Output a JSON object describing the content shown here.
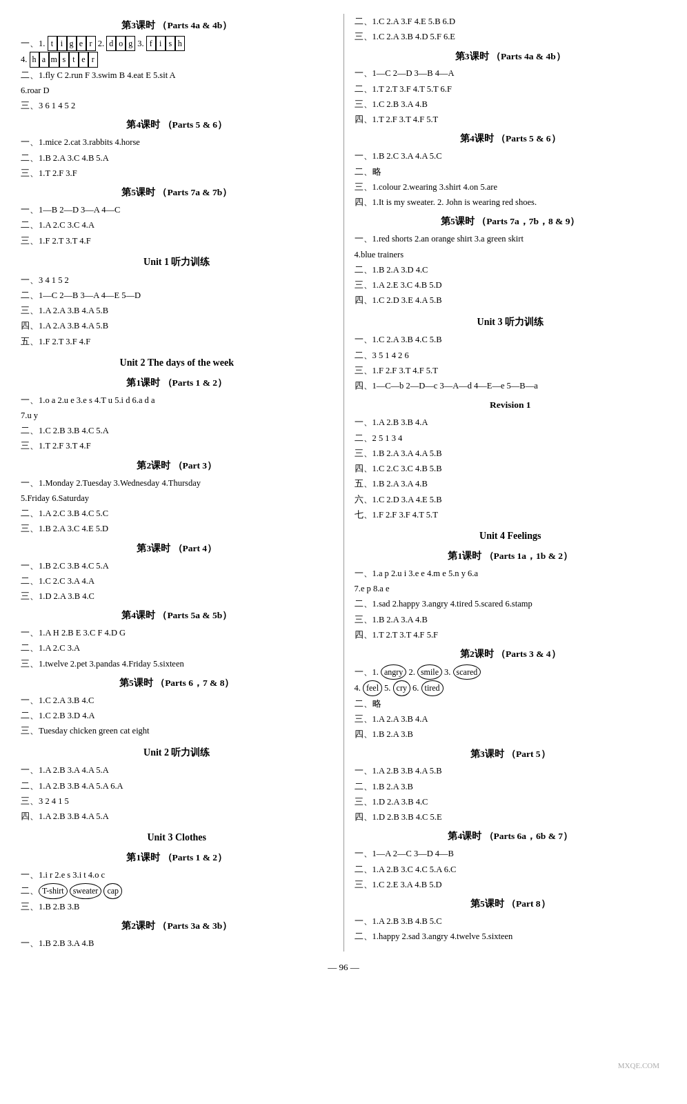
{
  "page": {
    "number": "96",
    "left_col": [
      {
        "type": "section",
        "text": "第3课时  （Parts 4a & 4b）"
      },
      {
        "type": "line",
        "text": "一、1. t i g e r  2. d o g  3. f i s h"
      },
      {
        "type": "line",
        "text": "4. h a m s t e r"
      },
      {
        "type": "line",
        "text": "二、1.fly  C  2.run  F  3.swim  B  4.eat  E  5.sit  A"
      },
      {
        "type": "line",
        "text": "6.roar  D"
      },
      {
        "type": "line",
        "text": "三、3  6  1  4  5  2"
      },
      {
        "type": "section",
        "text": "第4课时  （Parts 5 & 6）"
      },
      {
        "type": "line",
        "text": "一、1.mice  2.cat  3.rabbits  4.horse"
      },
      {
        "type": "line",
        "text": "二、1.B  2.A  3.C  4.B  5.A"
      },
      {
        "type": "line",
        "text": "三、1.T  2.F  3.F"
      },
      {
        "type": "section",
        "text": "第5课时  （Parts 7a & 7b）"
      },
      {
        "type": "line",
        "text": "一、1—B  2—D  3—A  4—C"
      },
      {
        "type": "line",
        "text": "二、1.A  2.C  3.C  4.A"
      },
      {
        "type": "line",
        "text": "三、1.F  2.T  3.T  4.F"
      },
      {
        "type": "unit",
        "text": "Unit 1  听力训练"
      },
      {
        "type": "line",
        "text": "一、3  4  1  5  2"
      },
      {
        "type": "line",
        "text": "二、1—C  2—B  3—A  4—E  5—D"
      },
      {
        "type": "line",
        "text": "三、1.A  2.A  3.B  4.A  5.B"
      },
      {
        "type": "line",
        "text": "四、1.A  2.A  3.B  4.A  5.B"
      },
      {
        "type": "line",
        "text": "五、1.F  2.T  3.F  4.F"
      },
      {
        "type": "unit",
        "text": "Unit 2  The days of the week"
      },
      {
        "type": "section",
        "text": "第1课时  （Parts 1 & 2）"
      },
      {
        "type": "line",
        "text": "一、1.o  a  2.u  e  3.e  s  4.T  u  5.i  d  6.a  d  a"
      },
      {
        "type": "line",
        "text": "7.u  y"
      },
      {
        "type": "line",
        "text": "二、1.C  2.B  3.B  4.C  5.A"
      },
      {
        "type": "line",
        "text": "三、1.T  2.F  3.T  4.F"
      },
      {
        "type": "section",
        "text": "第2课时  （Part 3）"
      },
      {
        "type": "line",
        "text": "一、1.Monday  2.Tuesday  3.Wednesday  4.Thursday"
      },
      {
        "type": "line",
        "text": "5.Friday  6.Saturday"
      },
      {
        "type": "line",
        "text": "二、1.A  2.C  3.B  4.C  5.C"
      },
      {
        "type": "line",
        "text": "三、1.B  2.A  3.C  4.E  5.D"
      },
      {
        "type": "section",
        "text": "第3课时  （Part 4）"
      },
      {
        "type": "line",
        "text": "一、1.B  2.C  3.B  4.C  5.A"
      },
      {
        "type": "line",
        "text": "二、1.C  2.C  3.A  4.A"
      },
      {
        "type": "line",
        "text": "三、1.D  2.A  3.B  4.C"
      },
      {
        "type": "section",
        "text": "第4课时  （Parts 5a & 5b）"
      },
      {
        "type": "line",
        "text": "一、1.A  H  2.B  E  3.C  F  4.D  G"
      },
      {
        "type": "line",
        "text": "二、1.A  2.C  3.A"
      },
      {
        "type": "line",
        "text": "三、1.twelve  2.pet  3.pandas  4.Friday  5.sixteen"
      },
      {
        "type": "section",
        "text": "第5课时  （Parts 6，7 & 8）"
      },
      {
        "type": "line",
        "text": "一、1.C  2.A  3.B  4.C"
      },
      {
        "type": "line",
        "text": "二、1.C  2.B  3.D  4.A"
      },
      {
        "type": "line",
        "text": "三、Tuesday  chicken  green  cat  eight"
      },
      {
        "type": "unit",
        "text": "Unit 2  听力训练"
      },
      {
        "type": "line",
        "text": "一、1.A  2.B  3.A  4.A  5.A"
      },
      {
        "type": "line",
        "text": "二、1.A  2.B  3.B  4.A  5.A  6.A"
      },
      {
        "type": "line",
        "text": "三、3  2  4  1  5"
      },
      {
        "type": "line",
        "text": "四、1.A  2.B  3.B  4.A  5.A"
      },
      {
        "type": "unit",
        "text": "Unit 3  Clothes"
      },
      {
        "type": "section",
        "text": "第1课时  （Parts 1 & 2）"
      },
      {
        "type": "line",
        "text": "一、1.i  r  2.e  s  3.i  t  4.o  c"
      },
      {
        "type": "line",
        "text": "二、T-shirt  sweater  cap  (circled)"
      },
      {
        "type": "line",
        "text": "三、1.B  2.B  3.B"
      },
      {
        "type": "section",
        "text": "第2课时  （Parts 3a & 3b）"
      },
      {
        "type": "line",
        "text": "一、1.B  2.B  3.A  4.B"
      }
    ],
    "right_col": [
      {
        "type": "line",
        "text": "二、1.C  2.A  3.F  4.E  5.B  6.D"
      },
      {
        "type": "line",
        "text": "三、1.C  2.A  3.B  4.D  5.F  6.E"
      },
      {
        "type": "section",
        "text": "第3课时  （Parts 4a & 4b）"
      },
      {
        "type": "line",
        "text": "一、1—C  2—D  3—B  4—A"
      },
      {
        "type": "line",
        "text": "二、1.T  2.T  3.F  4.T  5.T  6.F"
      },
      {
        "type": "line",
        "text": "三、1.C  2.B  3.A  4.B"
      },
      {
        "type": "line",
        "text": "四、1.T  2.F  3.T  4.F  5.T"
      },
      {
        "type": "section",
        "text": "第4课时  （Parts 5 & 6）"
      },
      {
        "type": "line",
        "text": "一、1.B  2.C  3.A  4.A  5.C"
      },
      {
        "type": "line",
        "text": "二、略"
      },
      {
        "type": "line",
        "text": "三、1.colour  2.wearing  3.shirt  4.on  5.are"
      },
      {
        "type": "line",
        "text": "四、1.It is my sweater.  2. John is wearing red shoes."
      },
      {
        "type": "section",
        "text": "第5课时  （Parts 7a，7b，8 & 9）"
      },
      {
        "type": "line",
        "text": "一、1.red shorts  2.an orange shirt  3.a green skirt"
      },
      {
        "type": "line",
        "text": "4.blue trainers"
      },
      {
        "type": "line",
        "text": "二、1.B  2.A  3.D  4.C"
      },
      {
        "type": "line",
        "text": "三、1.A  2.E  3.C  4.B  5.D"
      },
      {
        "type": "line",
        "text": "四、1.C  2.D  3.E  4.A  5.B"
      },
      {
        "type": "unit",
        "text": "Unit 3  听力训练"
      },
      {
        "type": "line",
        "text": "一、1.C  2.A  3.B  4.C  5.B"
      },
      {
        "type": "line",
        "text": "二、3  5  1  4  2  6"
      },
      {
        "type": "line",
        "text": "三、1.F  2.F  3.T  4.F  5.T"
      },
      {
        "type": "line",
        "text": "四、1—C—b  2—D—c  3—A—d  4—E—e  5—B—a"
      },
      {
        "type": "section",
        "text": "Revision 1"
      },
      {
        "type": "line",
        "text": "一、1.A  2.B  3.B  4.A"
      },
      {
        "type": "line",
        "text": "二、2  5  1  3  4"
      },
      {
        "type": "line",
        "text": "三、1.B  2.A  3.A  4.A  5.B"
      },
      {
        "type": "line",
        "text": "四、1.C  2.C  3.C  4.B  5.B"
      },
      {
        "type": "line",
        "text": "五、1.B  2.A  3.A  4.B"
      },
      {
        "type": "line",
        "text": "六、1.C  2.D  3.A  4.E  5.B"
      },
      {
        "type": "line",
        "text": "七、1.F  2.F  3.F  4.T  5.T"
      },
      {
        "type": "unit",
        "text": "Unit 4  Feelings"
      },
      {
        "type": "section",
        "text": "第1课时  （Parts 1a，1b & 2）"
      },
      {
        "type": "line",
        "text": "一、1.a  p  2.u  i  3.e  e  4.m  e  5.n  y  6.a"
      },
      {
        "type": "line",
        "text": "7.e  p  8.a  e"
      },
      {
        "type": "line",
        "text": "二、1.sad  2.happy  3.angry  4.tired  5.scared  6.stamp"
      },
      {
        "type": "line",
        "text": "三、1.B  2.A  3.A  4.B"
      },
      {
        "type": "line",
        "text": "四、1.T  2.T  3.T  4.F  5.F"
      },
      {
        "type": "section",
        "text": "第2课时  （Parts 3 & 4）"
      },
      {
        "type": "line",
        "text": "一、1.angry  2.smile  3.scared  (circled)"
      },
      {
        "type": "line",
        "text": "4.feel  5.cry  6.tired  (circled)"
      },
      {
        "type": "line",
        "text": "二、略"
      },
      {
        "type": "line",
        "text": "三、1.A  2.A  3.B  4.A"
      },
      {
        "type": "line",
        "text": "四、1.B  2.A  3.B"
      },
      {
        "type": "section",
        "text": "第3课时  （Part 5）"
      },
      {
        "type": "line",
        "text": "一、1.A  2.B  3.B  4.A  5.B"
      },
      {
        "type": "line",
        "text": "二、1.B  2.A  3.B"
      },
      {
        "type": "line",
        "text": "三、1.D  2.A  3.B  4.C"
      },
      {
        "type": "line",
        "text": "四、1.D  2.B  3.B  4.C  5.E"
      },
      {
        "type": "section",
        "text": "第4课时  （Parts 6a，6b & 7）"
      },
      {
        "type": "line",
        "text": "一、1—A  2—C  3—D  4—B"
      },
      {
        "type": "line",
        "text": "二、1.A  2.B  3.C  4.C  5.A  6.C"
      },
      {
        "type": "line",
        "text": "三、1.C  2.E  3.A  4.B  5.D"
      },
      {
        "type": "section",
        "text": "第5课时  （Part 8）"
      },
      {
        "type": "line",
        "text": "一、1.A  2.B  3.B  4.B  5.C"
      },
      {
        "type": "line",
        "text": "二、1.happy  2.sad  3.angry  4.twelve  5.sixteen"
      }
    ]
  }
}
